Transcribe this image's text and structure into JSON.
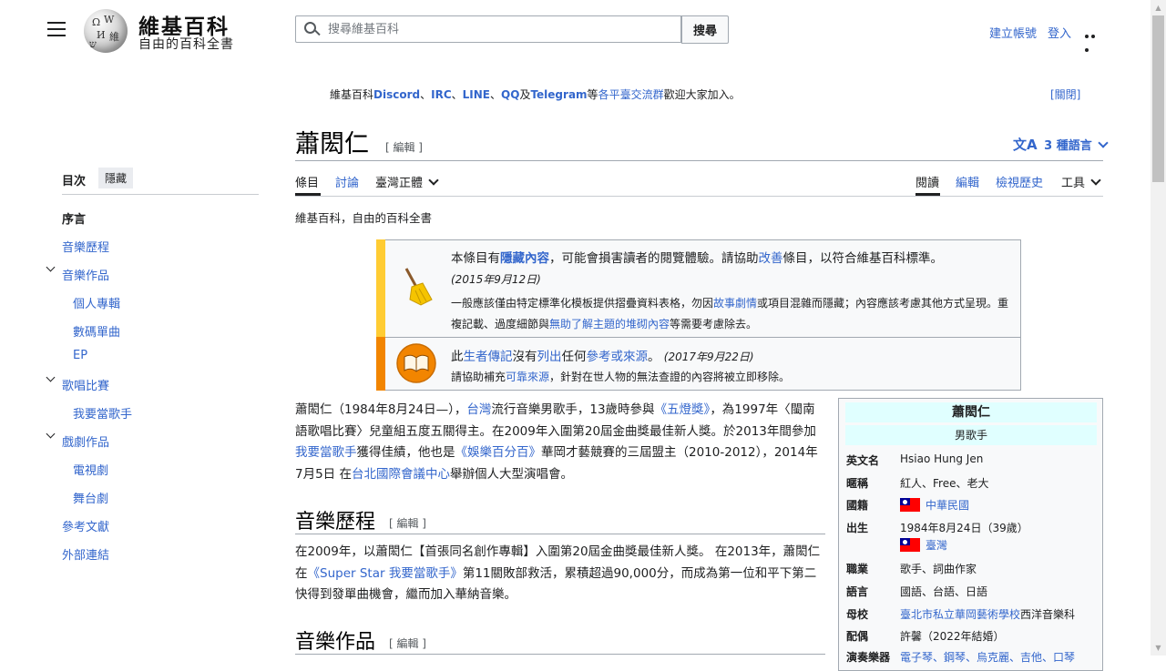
{
  "header": {
    "site_title": "維基百科",
    "site_tagline": "自由的百科全書",
    "search_placeholder": "搜尋維基百科",
    "search_button": "搜尋",
    "create_account": "建立帳號",
    "login": "登入"
  },
  "notice": {
    "prefix": "維基百科",
    "discord": "Discord",
    "sep1": "、",
    "irc": "IRC",
    "sep2": "、",
    "line": "LINE",
    "sep3": "、",
    "qq": "QQ",
    "and": "及",
    "telegram": "Telegram",
    "mid": "等",
    "groups": "各平臺交流群",
    "suffix": "歡迎大家加入。",
    "close": "[關閉]"
  },
  "page": {
    "title": "蕭閎仁",
    "edit_label": "[ 編輯 ]",
    "languages": "3 種語言",
    "subtitle": "維基百科，自由的百科全書"
  },
  "tabs": {
    "article": "條目",
    "talk": "討論",
    "variant": "臺灣正體",
    "read": "閱讀",
    "edit": "編輯",
    "history": "檢視歷史",
    "tools": "工具"
  },
  "toc": {
    "heading": "目次",
    "hide": "隱藏",
    "items": [
      {
        "label": "序言"
      },
      {
        "label": "音樂歷程"
      },
      {
        "label": "音樂作品"
      },
      {
        "label": "個人專輯"
      },
      {
        "label": "數碼單曲"
      },
      {
        "label": "EP"
      },
      {
        "label": "歌唱比賽"
      },
      {
        "label": "我要當歌手"
      },
      {
        "label": "戲劇作品"
      },
      {
        "label": "電視劇"
      },
      {
        "label": "舞台劇"
      },
      {
        "label": "參考文獻"
      },
      {
        "label": "外部連結"
      }
    ]
  },
  "ambox": {
    "box1": {
      "t1": "本條目有",
      "link1": "隱藏內容",
      "t2": "，可能會損害讀者的閱覽體驗。請協助",
      "link2": "改善",
      "t3": "條目，以符合維基百科標準。",
      "date": "(2015年9月12日)",
      "d1": "一般應該僅由特定標準化模板提供摺疊資料表格，勿因",
      "dlink1": "故事劇情",
      "d2": "或項目混雜而隱藏；內容應該考慮其他方式呈現。重複記載、過度細節與",
      "dlink2": "無助了解主題的堆砌內容",
      "d3": "等需要考慮除去。"
    },
    "box2": {
      "t1": "此",
      "link1": "生者傳記",
      "t2": "沒有",
      "link2": "列出",
      "t3": "任何",
      "link3": "參考或來源",
      "t4": "。",
      "date": "(2017年9月22日)",
      "d1": "請協助補充",
      "dlink1": "可靠來源",
      "d2": "，針對在世人物的無法查證的內容將被立即移除。"
    }
  },
  "lead": {
    "p1": "蕭閎仁（1984年8月24日—），",
    "l1": "台灣",
    "p2": "流行音樂男歌手，13歲時參與",
    "l2": "《五燈獎》",
    "p3": "，為1997年〈閩南語歌唱比賽〉兒童組五度五關得主。在2009年入圍第20屆金曲獎最佳新人獎。於2013年間參加",
    "l3": "我要當歌手",
    "p4": "獲得佳績，他也是",
    "l4": "《娛樂百分百》",
    "p5": "華岡才藝競賽的三屆盟主（2010-2012），2014年7月5日 在",
    "l5": "台北國際會議中心",
    "p6": "舉辦個人大型演唱會。"
  },
  "section1": {
    "heading": "音樂歷程",
    "edit": "[ 編輯 ]",
    "p1": "在2009年，以蕭閎仁【首張同名創作專輯】入圍第20屆金曲獎最佳新人獎。 在2013年，蕭閎仁在",
    "l1": "《Super Star 我要當歌手》",
    "p2": "第11關敗部救活，累積超過90,000分，而成為第一位和平下第二快得到發單曲機會，繼而加入華納音樂。"
  },
  "section2": {
    "heading": "音樂作品",
    "edit": "[ 編輯 ]"
  },
  "infobox": {
    "name": "蕭閎仁",
    "role": "男歌手",
    "rows": [
      {
        "label": "英文名",
        "value": "Hsiao Hung Jen"
      },
      {
        "label": "暱稱",
        "value": "紅人、Free、老大"
      },
      {
        "label": "國籍",
        "value": "中華民國"
      },
      {
        "label": "出生",
        "value": "1984年8月24日（39歲）",
        "value2": "臺灣"
      },
      {
        "label": "職業",
        "value": "歌手、詞曲作家"
      },
      {
        "label": "語言",
        "value": "國語、台語、日語"
      },
      {
        "label": "母校",
        "value": "臺北市私立華岡藝術學校",
        "value_suffix": "西洋音樂科"
      },
      {
        "label": "配偶",
        "value": "許馨（2022年結婚）"
      },
      {
        "label": "演奏樂器",
        "value": "電子琴、鋼琴、烏克麗、吉他、口琴"
      }
    ]
  }
}
